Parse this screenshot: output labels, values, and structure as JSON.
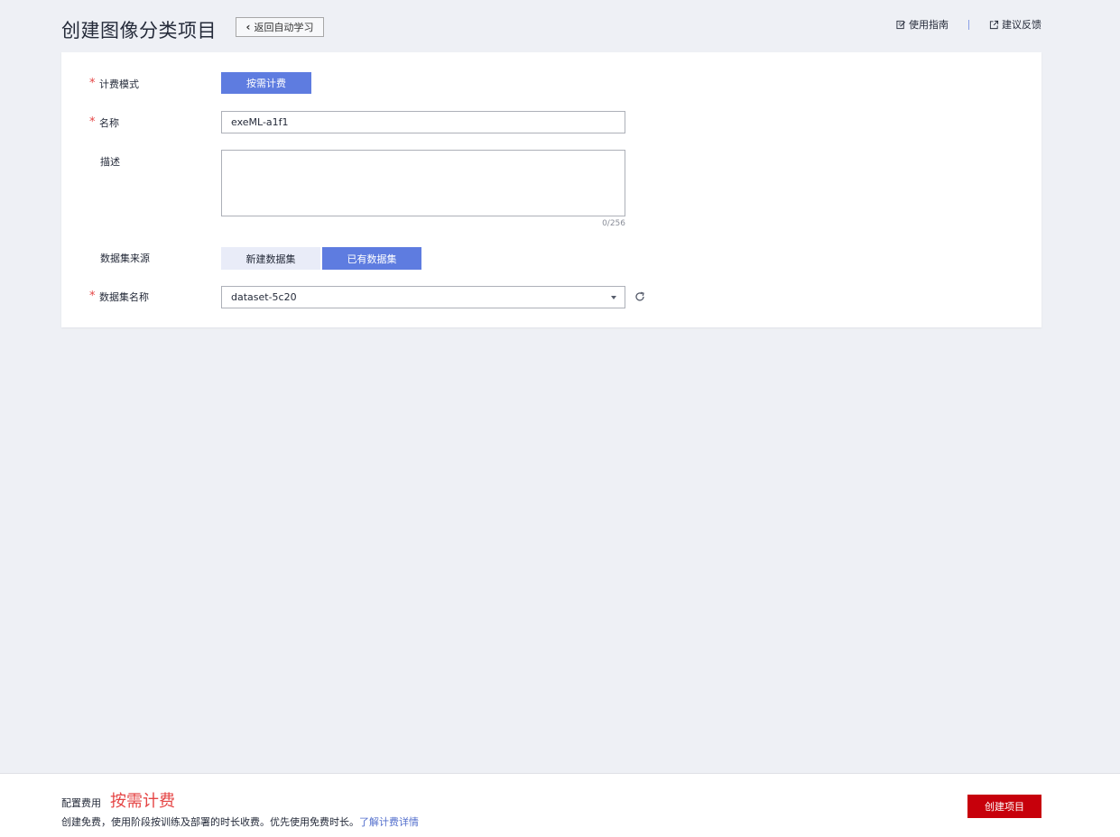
{
  "header": {
    "title": "创建图像分类项目",
    "back_label": "返回自动学习",
    "guide_label": "使用指南",
    "feedback_label": "建议反馈"
  },
  "form": {
    "billing": {
      "label": "计费模式",
      "required": true,
      "option": "按需计费"
    },
    "name": {
      "label": "名称",
      "required": true,
      "value": "exeML-a1f1"
    },
    "description": {
      "label": "描述",
      "required": false,
      "value": "",
      "counter": "0/256"
    },
    "dataset_source": {
      "label": "数据集来源",
      "options": [
        "新建数据集",
        "已有数据集"
      ],
      "selected": "已有数据集"
    },
    "dataset_name": {
      "label": "数据集名称",
      "required": true,
      "value": "dataset-5c20"
    }
  },
  "footer": {
    "fee_label": "配置费用",
    "fee_value": "按需计费",
    "note": "创建免费，使用阶段按训练及部署的时长收费。优先使用免费时长。",
    "note_link": "了解计费详情",
    "create_label": "创建项目"
  },
  "colors": {
    "primary": "#5e7ce0",
    "danger": "#c7000b",
    "required_mark": "#e54545",
    "background": "#eef0f5"
  },
  "icons": {
    "back": "chevron-left-icon",
    "guide": "edit-doc-icon",
    "feedback": "external-link-icon",
    "refresh": "refresh-icon",
    "select": "caret-down-icon"
  }
}
